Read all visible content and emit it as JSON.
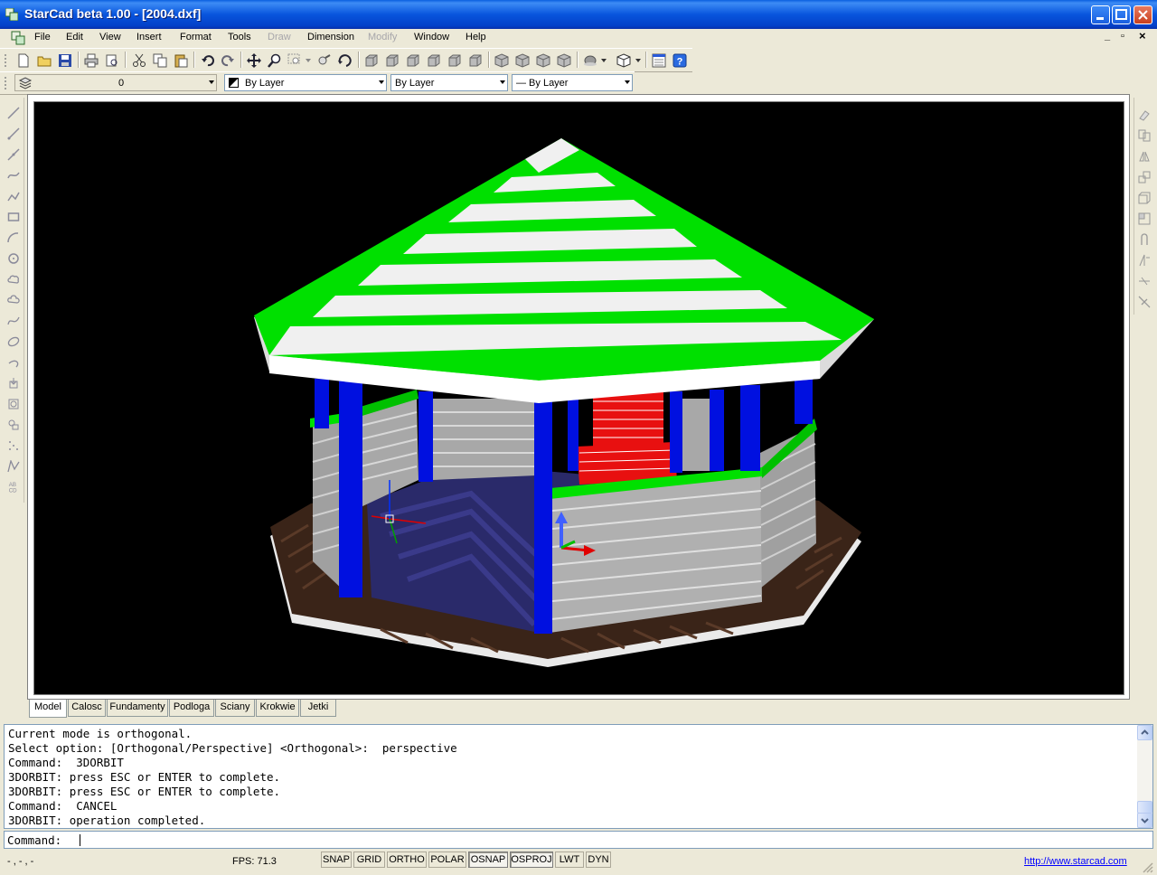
{
  "window": {
    "title": "StarCad beta 1.00 - [2004.dxf]"
  },
  "menu": {
    "items": [
      {
        "label": "File",
        "enabled": true
      },
      {
        "label": "Edit",
        "enabled": true
      },
      {
        "label": "View",
        "enabled": true
      },
      {
        "label": "Insert",
        "enabled": true
      },
      {
        "label": "Format",
        "enabled": true
      },
      {
        "label": "Tools",
        "enabled": true
      },
      {
        "label": "Draw",
        "enabled": false
      },
      {
        "label": "Dimension",
        "enabled": true
      },
      {
        "label": "Modify",
        "enabled": false
      },
      {
        "label": "Window",
        "enabled": true
      },
      {
        "label": "Help",
        "enabled": true
      }
    ],
    "mdi_minimize": "_",
    "mdi_restore": "▫",
    "mdi_close": "×"
  },
  "properties_toolbar": {
    "layer": "0",
    "color": "By Layer",
    "linetype": "By Layer",
    "lineweight": "— By Layer"
  },
  "tabs": [
    "Model",
    "Calosc",
    "Fundamenty",
    "Podloga",
    "Sciany",
    "Krokwie",
    "Jetki"
  ],
  "active_tab": "Model",
  "command_history": [
    "Current mode is orthogonal.",
    "Select option: [Orthogonal/Perspective] <Orthogonal>:  perspective",
    "Command:  3DORBIT",
    "3DORBIT: press ESC or ENTER to complete.",
    "3DORBIT: press ESC or ENTER to complete.",
    "Command:  CANCEL",
    "3DORBIT: operation completed."
  ],
  "command_prompt": "Command:",
  "command_input": "",
  "status": {
    "coordinates": "- , - , -",
    "fps": "FPS: 71.3",
    "toggles": [
      {
        "label": "SNAP",
        "on": false
      },
      {
        "label": "GRID",
        "on": false
      },
      {
        "label": "ORTHO",
        "on": false
      },
      {
        "label": "POLAR",
        "on": false
      },
      {
        "label": "OSNAP",
        "on": true
      },
      {
        "label": "OSPROJ",
        "on": true
      },
      {
        "label": "LWT",
        "on": false
      },
      {
        "label": "DYN",
        "on": false
      }
    ],
    "url": "http://www.starcad.com"
  },
  "colors": {
    "roof_green": "#00e000",
    "roof_white": "#f0f0f0",
    "post_blue": "#0010e0",
    "wall_gray": "#a8a8a8",
    "brick_red": "#e81010",
    "floor_brown": "#3a2418",
    "floor_inner": "#2a2a6a"
  }
}
